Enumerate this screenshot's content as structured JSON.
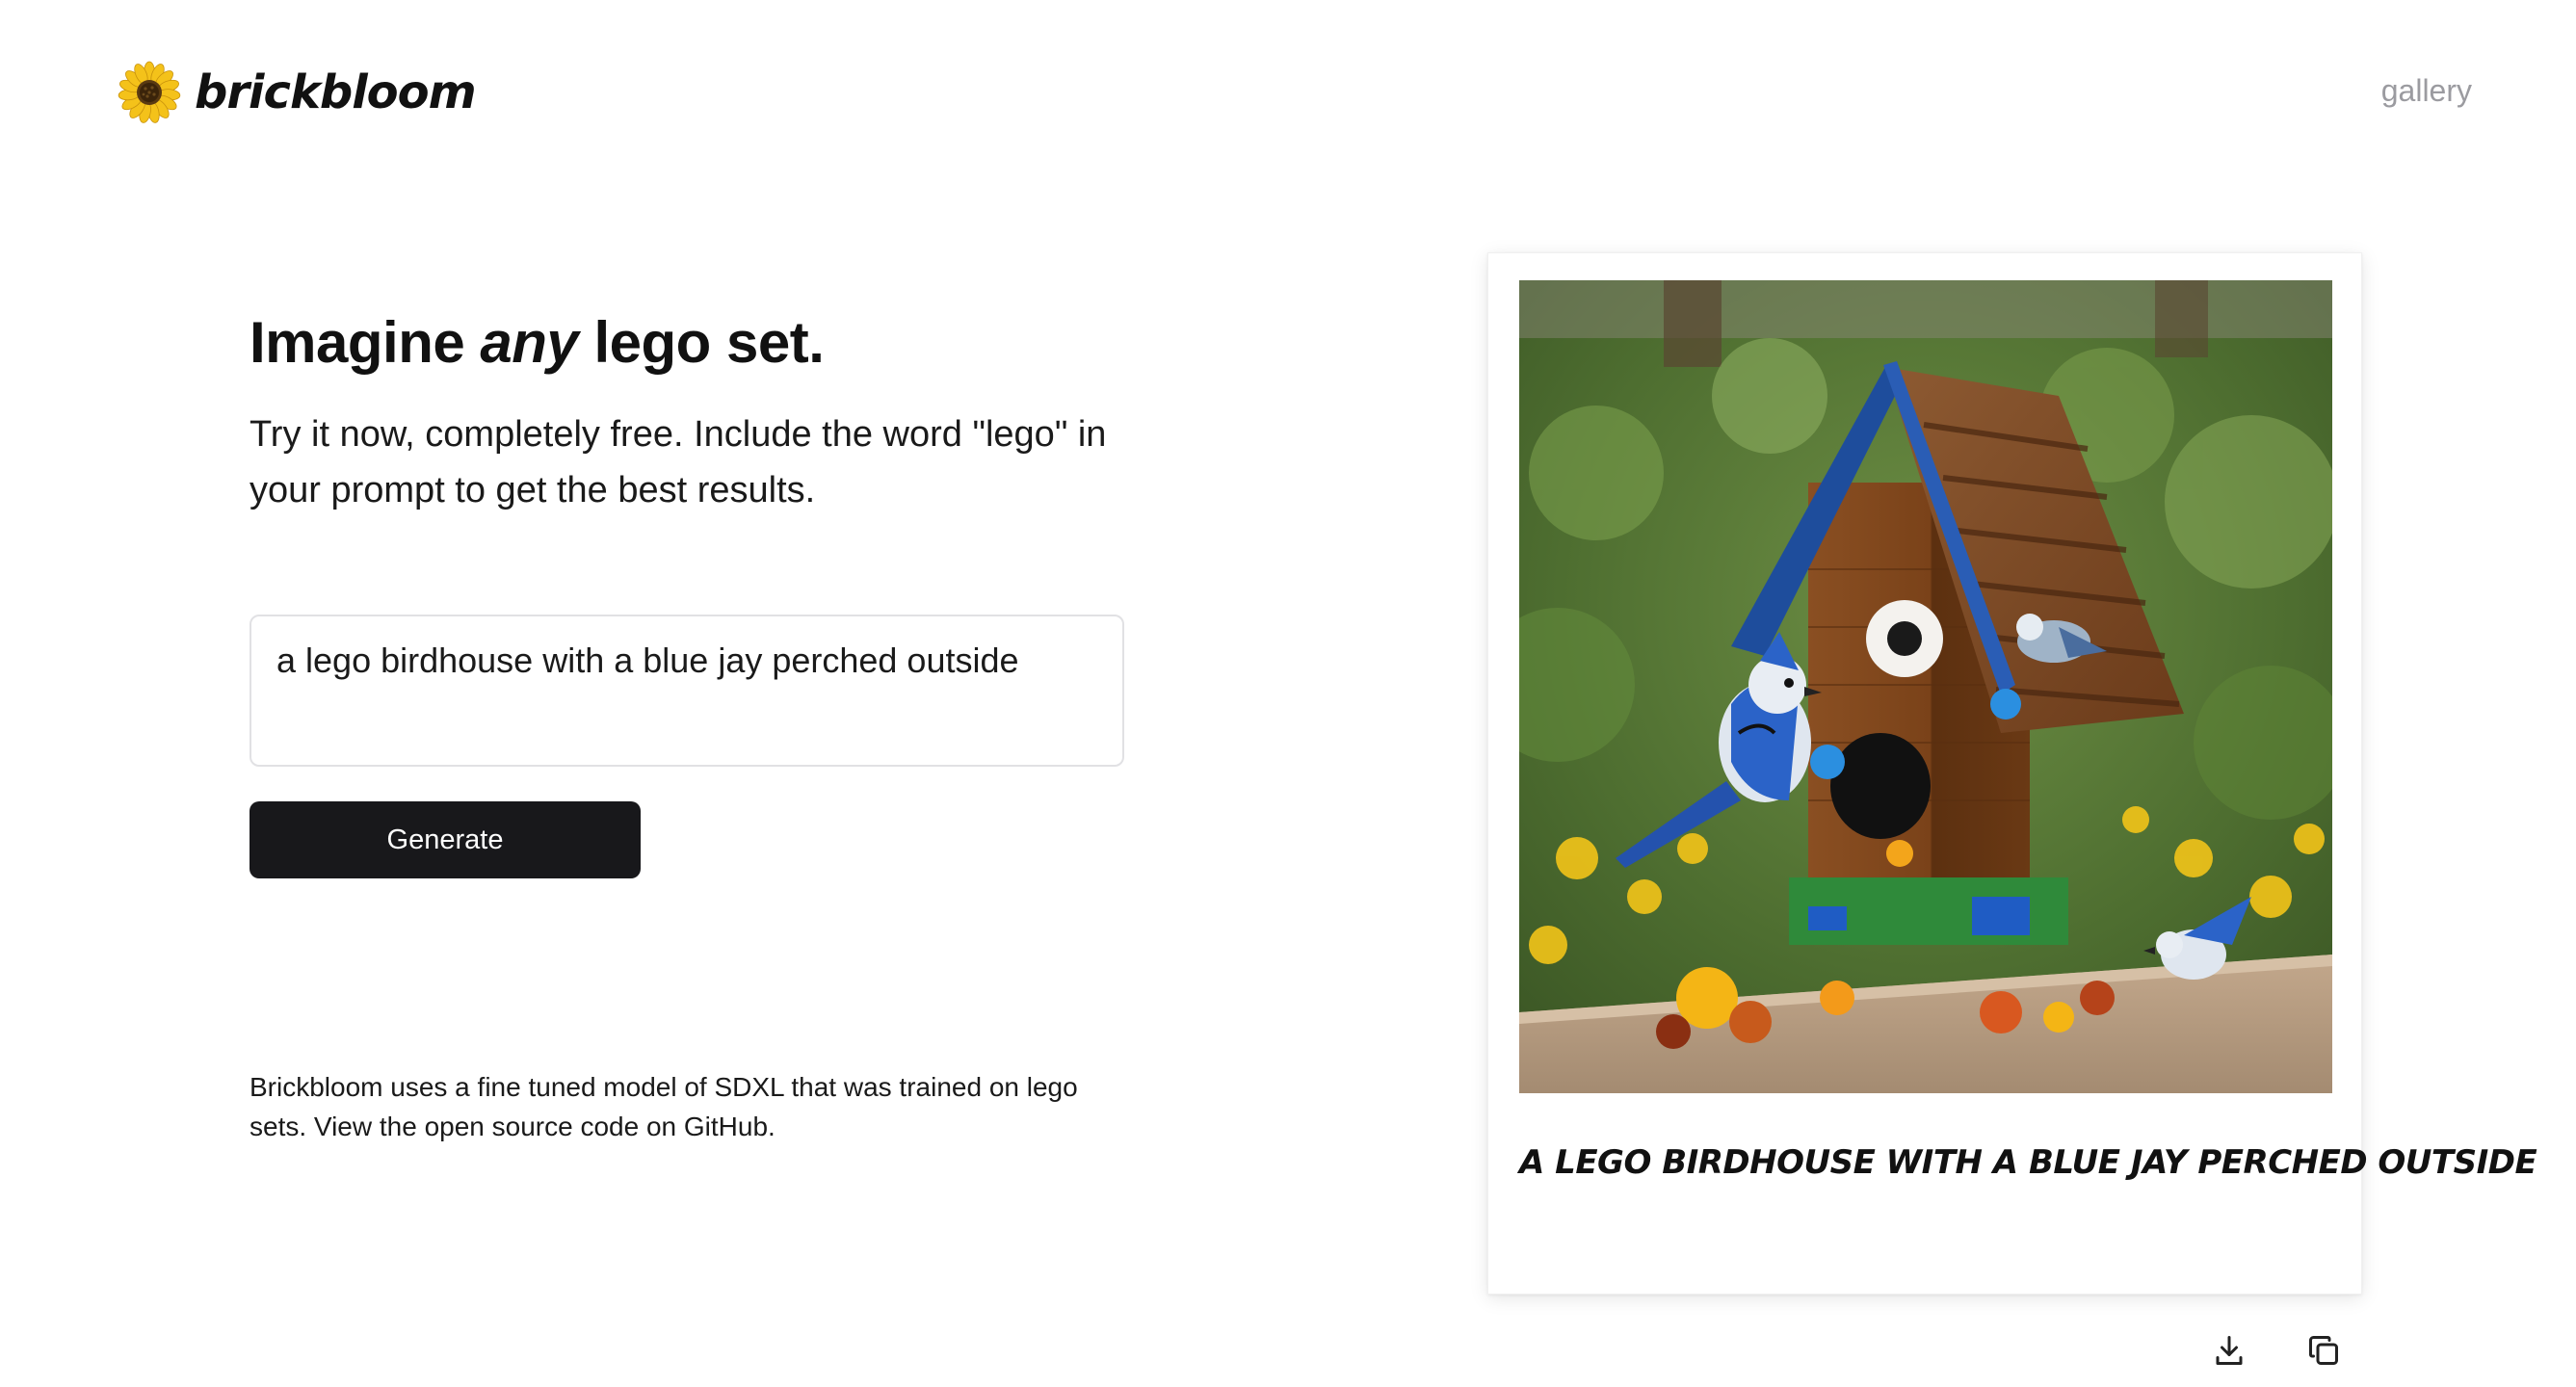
{
  "header": {
    "brand_name": "brickbloom",
    "logo_icon": "sunflower-icon",
    "nav": {
      "gallery_label": "gallery"
    }
  },
  "hero": {
    "headline_before": "Imagine ",
    "headline_emphasis": "any",
    "headline_after": " lego set.",
    "subtitle": "Try it now, completely free. Include the word \"lego\" in your prompt to get the best results."
  },
  "prompt": {
    "value": "a lego birdhouse with a blue jay perched outside"
  },
  "generate_button": {
    "label": "Generate"
  },
  "footer_note": "Brickbloom uses a fine tuned model of SDXL that was trained on lego sets. View the open source code on GitHub.",
  "result": {
    "caption": "a lego birdhouse with a blue jay perched outside",
    "image_subject": "lego birdhouse with blue jays",
    "actions": [
      {
        "icon": "download-icon"
      },
      {
        "icon": "copy-icon"
      }
    ]
  },
  "colors": {
    "button_bg": "#18181b",
    "nav_text": "#9b9ba0",
    "border": "#e1e1e4"
  }
}
